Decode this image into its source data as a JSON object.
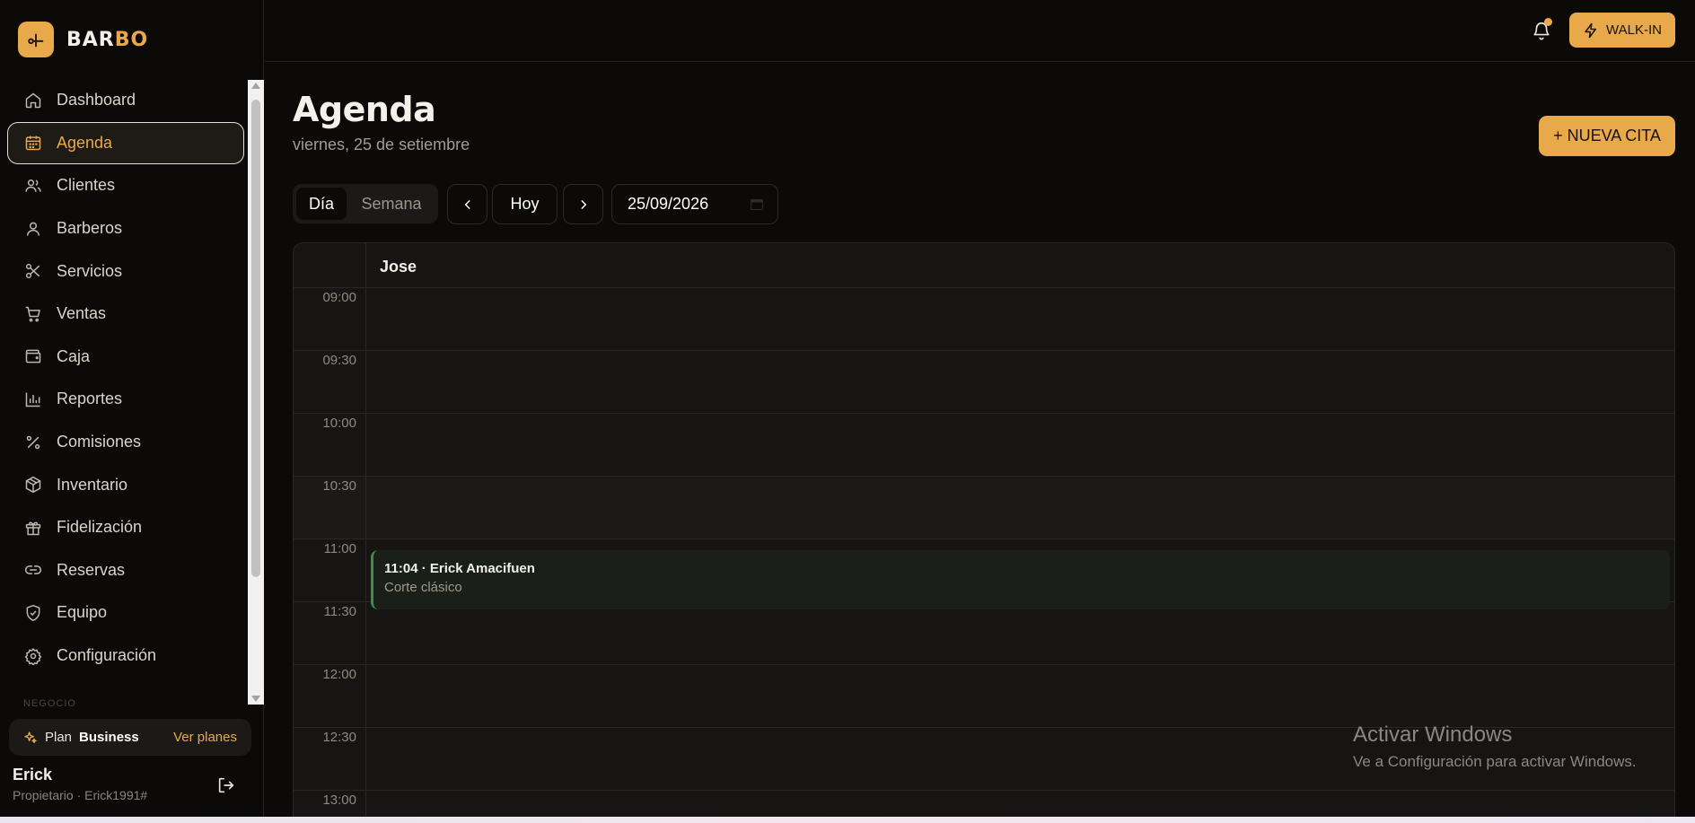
{
  "app": {
    "brand_part1": "BAR",
    "brand_part2": "BO"
  },
  "sidebar": {
    "items": [
      {
        "label": "Dashboard",
        "icon": "home-icon"
      },
      {
        "label": "Agenda",
        "icon": "calendar-icon",
        "active": true
      },
      {
        "label": "Clientes",
        "icon": "users-icon"
      },
      {
        "label": "Barberos",
        "icon": "user-icon"
      },
      {
        "label": "Servicios",
        "icon": "scissors-icon"
      },
      {
        "label": "Ventas",
        "icon": "cart-icon"
      },
      {
        "label": "Caja",
        "icon": "wallet-icon"
      },
      {
        "label": "Reportes",
        "icon": "bar-chart-icon"
      },
      {
        "label": "Comisiones",
        "icon": "percent-icon"
      },
      {
        "label": "Inventario",
        "icon": "box-icon"
      },
      {
        "label": "Fidelización",
        "icon": "gift-icon"
      },
      {
        "label": "Reservas",
        "icon": "link-icon"
      },
      {
        "label": "Equipo",
        "icon": "shield-icon"
      },
      {
        "label": "Configuración",
        "icon": "gear-icon"
      }
    ],
    "section_label": "NEGOCIO",
    "plan": {
      "label": "Plan",
      "name": "Business",
      "link": "Ver planes"
    },
    "user": {
      "name": "Erick",
      "role": "Propietario · Erick1991#"
    }
  },
  "topbar": {
    "walkin_label": "WALK-IN"
  },
  "header": {
    "title": "Agenda",
    "date": "viernes, 25 de setiembre",
    "new_button": "+ NUEVA CITA"
  },
  "toolbar": {
    "view_day": "Día",
    "view_week": "Semana",
    "today": "Hoy",
    "date_value": "25/09/2026"
  },
  "calendar": {
    "barber": "Jose",
    "times": [
      "09:00",
      "09:30",
      "10:00",
      "10:30",
      "11:00",
      "11:30",
      "12:00",
      "12:30",
      "13:00"
    ],
    "appointment": {
      "title": "11:04 · Erick Amacifuen",
      "service": "Corte clásico",
      "color": "#3f8e47"
    }
  },
  "watermark": {
    "title": "Activar Windows",
    "subtitle": "Ve a Configuración para activar Windows."
  },
  "colors": {
    "accent": "#e8a94a",
    "background": "#0b0a09"
  }
}
